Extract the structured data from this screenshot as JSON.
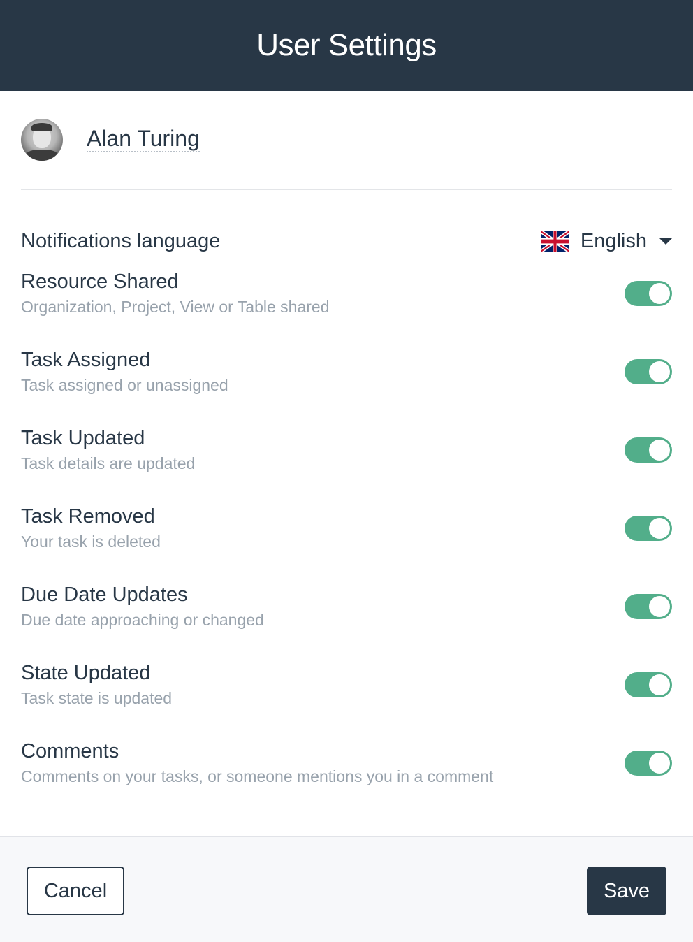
{
  "header": {
    "title": "User Settings"
  },
  "user": {
    "name": "Alan Turing",
    "avatar_icon": "user-photo"
  },
  "language": {
    "label": "Notifications language",
    "selected": "English",
    "flag_icon": "uk-flag-icon",
    "dropdown_icon": "caret-down-icon"
  },
  "settings": [
    {
      "title": "Resource Shared",
      "description": "Organization, Project, View or Table shared",
      "enabled": true
    },
    {
      "title": "Task Assigned",
      "description": "Task assigned or unassigned",
      "enabled": true
    },
    {
      "title": "Task Updated",
      "description": "Task details are updated",
      "enabled": true
    },
    {
      "title": "Task Removed",
      "description": "Your task is deleted",
      "enabled": true
    },
    {
      "title": "Due Date Updates",
      "description": "Due date approaching or changed",
      "enabled": true
    },
    {
      "title": "State Updated",
      "description": "Task state is updated",
      "enabled": true
    },
    {
      "title": "Comments",
      "description": "Comments on your tasks, or someone mentions you in a comment",
      "enabled": true
    }
  ],
  "footer": {
    "cancel_label": "Cancel",
    "save_label": "Save"
  },
  "colors": {
    "header_bg": "#283746",
    "toggle_on": "#52ae8a",
    "text_primary": "#283746",
    "text_secondary": "#98a2ac"
  }
}
